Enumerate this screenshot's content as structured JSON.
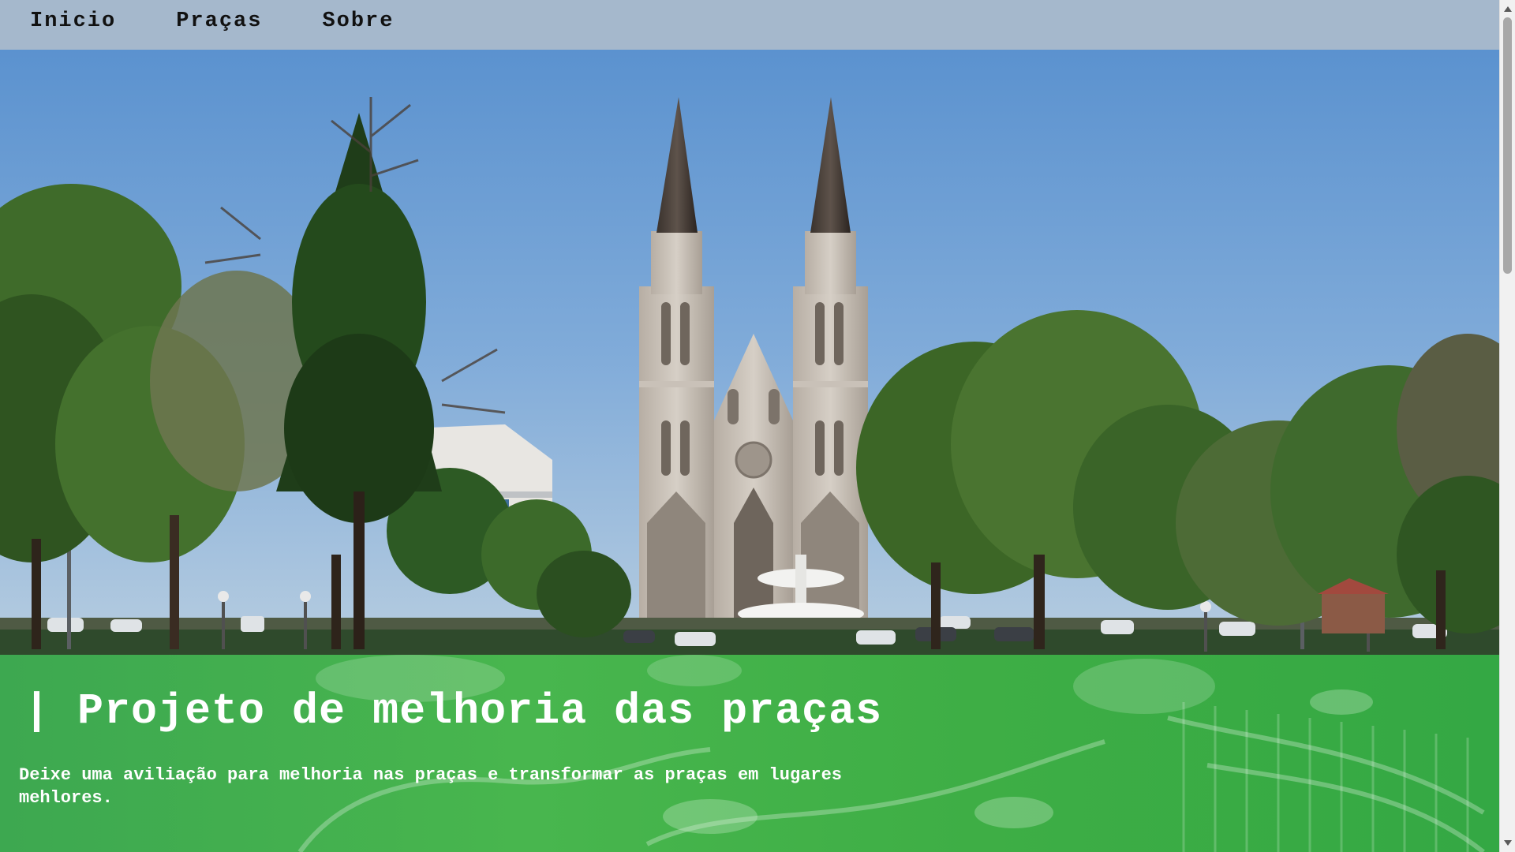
{
  "nav": {
    "items": [
      {
        "label": "Inicio"
      },
      {
        "label": "Praças"
      },
      {
        "label": "Sobre"
      }
    ]
  },
  "banner": {
    "title": "| Projeto de melhoria das praças",
    "description": "Deixe uma aviliação para melhoria nas praças e transformar as praças em lugares mehlores."
  },
  "colors": {
    "nav_bg": "#a5b8cc",
    "banner_green": "#3fae47",
    "text_white": "#ffffff"
  },
  "scrollbar": {
    "position_fraction": 0.0
  }
}
